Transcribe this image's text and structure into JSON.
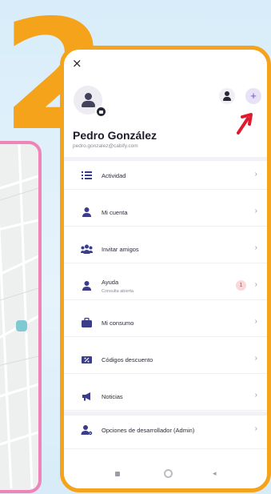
{
  "decor": {
    "step_number": "2",
    "colors": {
      "accent": "#f5a31a",
      "map_frame": "#ee84b8",
      "purple": "#6d4fd8",
      "arrow": "#e0192e"
    }
  },
  "profile": {
    "name": "Pedro González",
    "email": "pedro.gonzalez@cabify.com"
  },
  "icons": {
    "close": "×",
    "add": "+",
    "chevron": "›",
    "back": "◂"
  },
  "menu": [
    {
      "label": "Actividad",
      "icon": "list-icon"
    },
    {
      "label": "Mi cuenta",
      "icon": "person-icon"
    },
    {
      "label": "Invitar amigos",
      "icon": "group-icon"
    },
    {
      "label": "Ayuda",
      "sublabel": "Consulta abierta",
      "badge": "1",
      "icon": "help-person-icon"
    },
    {
      "label": "Mi consumo",
      "icon": "briefcase-icon"
    },
    {
      "label": "Códigos descuento",
      "icon": "ticket-icon"
    },
    {
      "label": "Noticias",
      "icon": "megaphone-icon"
    }
  ],
  "developer": {
    "label": "Opciones de desarrollador (Admin)",
    "icon": "person-gear-icon"
  }
}
